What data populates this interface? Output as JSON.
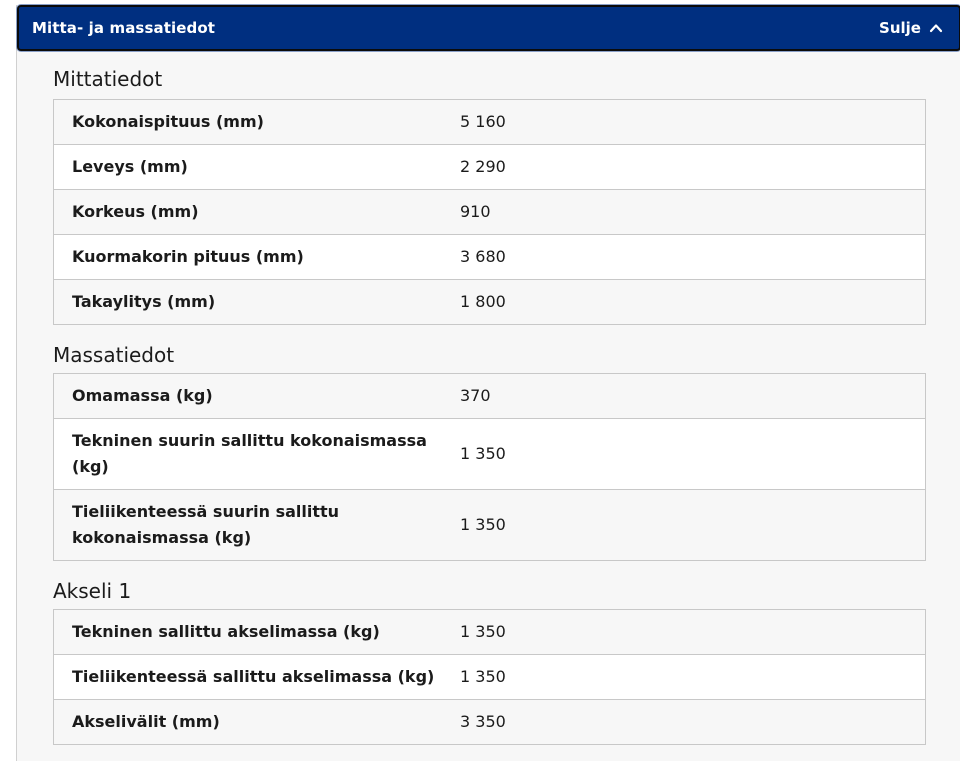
{
  "accordion": {
    "title": "Mitta- ja massatiedot",
    "toggle_label": "Sulje",
    "toggle_icon": "chevron-up-icon",
    "header_color": "#002f80"
  },
  "sections": [
    {
      "title": "Mittatiedot",
      "rows": [
        {
          "label": "Kokonaispituus (mm)",
          "value": "5 160"
        },
        {
          "label": "Leveys (mm)",
          "value": "2 290"
        },
        {
          "label": "Korkeus (mm)",
          "value": "910"
        },
        {
          "label": "Kuormakorin pituus (mm)",
          "value": "3 680"
        },
        {
          "label": "Takaylitys (mm)",
          "value": "1 800"
        }
      ]
    },
    {
      "title": "Massatiedot",
      "rows": [
        {
          "label": "Omamassa (kg)",
          "value": "370"
        },
        {
          "label": "Tekninen suurin sallittu kokonaismassa (kg)",
          "value": "1 350"
        },
        {
          "label": "Tieliikenteessä suurin sallittu kokonaismassa (kg)",
          "value": "1 350"
        }
      ]
    },
    {
      "title": "Akseli 1",
      "rows": [
        {
          "label": "Tekninen sallittu akselimassa (kg)",
          "value": "1 350"
        },
        {
          "label": "Tieliikenteessä sallittu akselimassa (kg)",
          "value": "1 350"
        },
        {
          "label": "Akselivälit (mm)",
          "value": "3 350"
        }
      ]
    }
  ]
}
